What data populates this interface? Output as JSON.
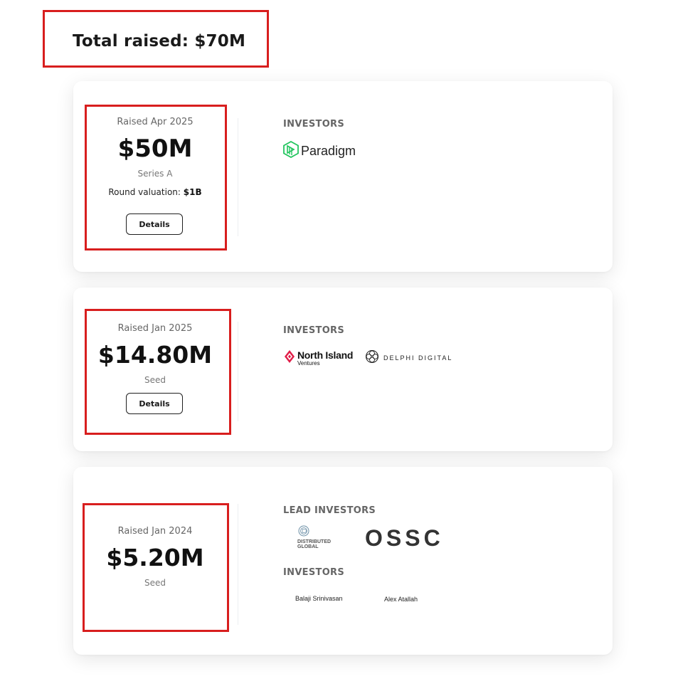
{
  "header": {
    "total_raised": "Total raised: $70M"
  },
  "rounds": [
    {
      "raised_date": "Raised Apr 2025",
      "amount": "$50M",
      "stage": "Series A",
      "valuation_label": "Round valuation: ",
      "valuation_value": "$1B",
      "details_label": "Details",
      "investors_label": "INVESTORS",
      "investors": [
        {
          "name": "Paradigm",
          "icon": "paradigm-logo"
        }
      ]
    },
    {
      "raised_date": "Raised Jan 2025",
      "amount": "$14.80M",
      "stage": "Seed",
      "details_label": "Details",
      "investors_label": "INVESTORS",
      "investors": [
        {
          "name": "North Island",
          "subtitle": "Ventures",
          "icon": "north-island-logo"
        },
        {
          "name": "DELPHI DIGITAL",
          "icon": "delphi-digital-logo"
        }
      ]
    },
    {
      "raised_date": "Raised Jan 2024",
      "amount": "$5.20M",
      "stage": "Seed",
      "lead_investors_label": "LEAD INVESTORS",
      "lead_investors": [
        {
          "name_line1": "DISTRIBUTED",
          "name_line2": "GLOBAL",
          "icon": "distributed-global-logo"
        },
        {
          "name": "OSSC",
          "icon": "ossc-logo"
        }
      ],
      "investors_label": "INVESTORS",
      "investors": [
        {
          "name": "Balaji Srinivasan"
        },
        {
          "name": "Alex Atallah"
        }
      ]
    }
  ],
  "colors": {
    "highlight": "#d81e1e",
    "paradigm_green": "#22c55e",
    "north_island_red": "#e11d48"
  }
}
